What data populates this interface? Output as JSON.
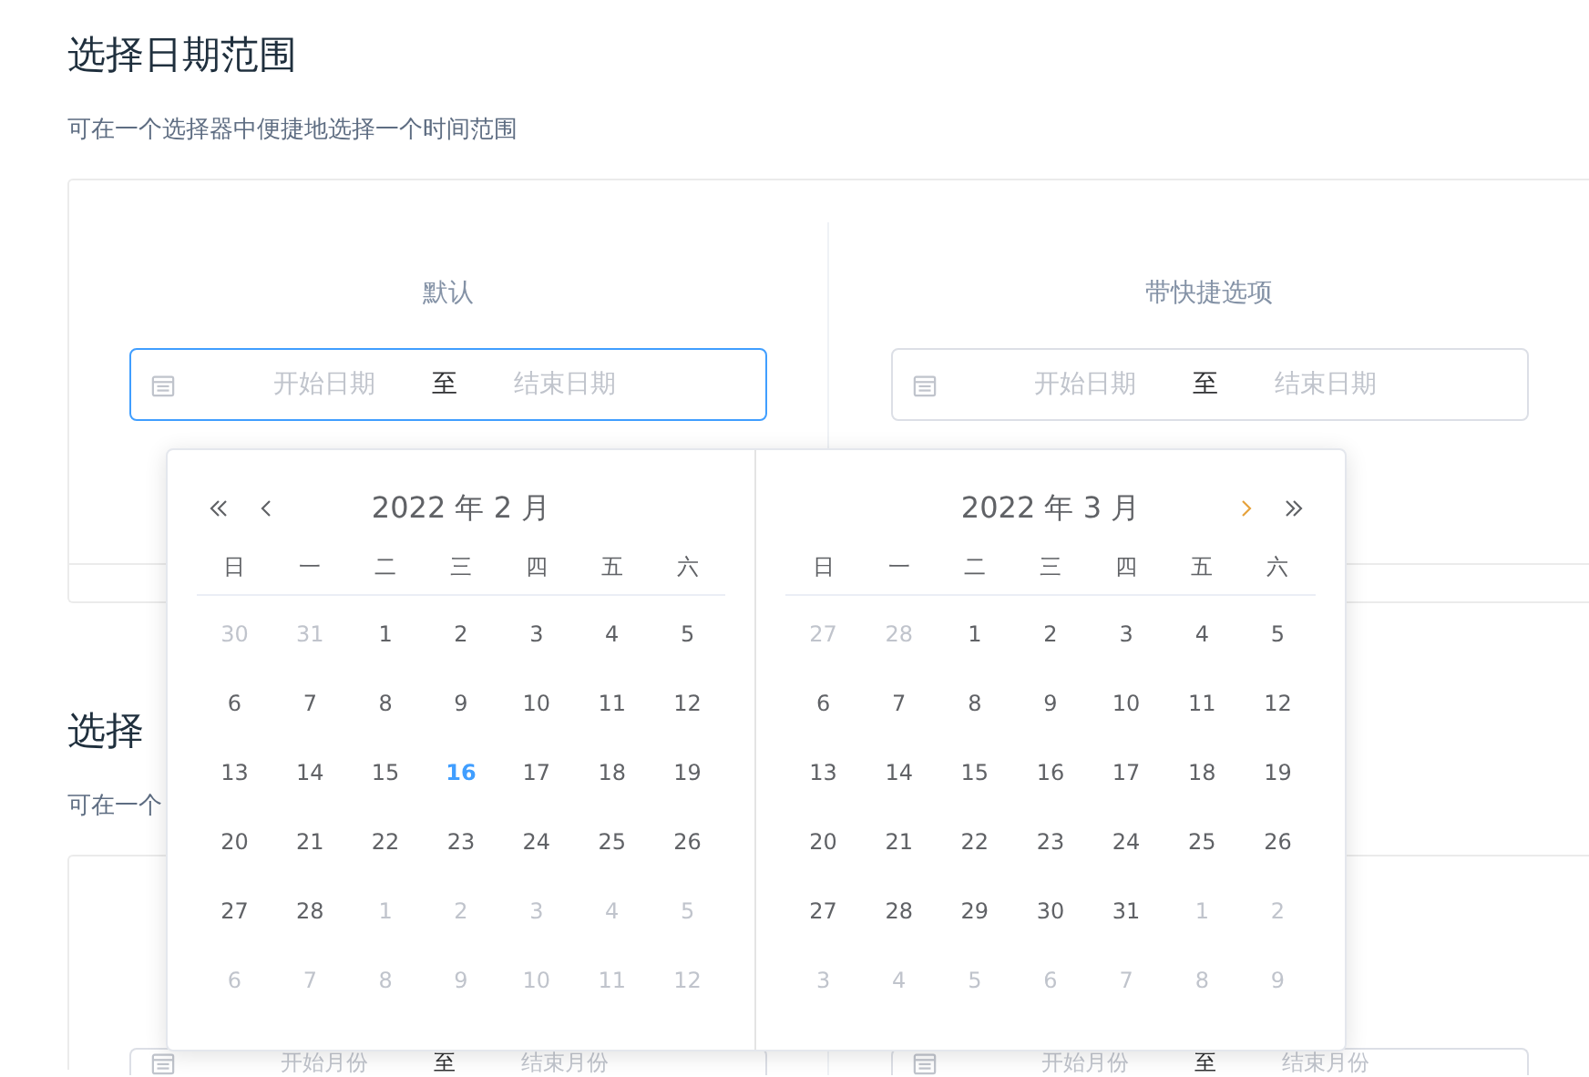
{
  "sections": [
    {
      "title": "选择日期范围",
      "description": "可在一个选择器中便捷地选择一个时间范围",
      "demos": [
        {
          "label": "默认",
          "focused": true,
          "start_placeholder": "开始日期",
          "separator": "至",
          "end_placeholder": "结束日期"
        },
        {
          "label": "带快捷选项",
          "focused": false,
          "start_placeholder": "开始日期",
          "separator": "至",
          "end_placeholder": "结束日期"
        }
      ]
    },
    {
      "title": "选择",
      "description": "可在一个",
      "demos": [
        {
          "focused": false,
          "start_placeholder": "开始月份",
          "separator": "至",
          "end_placeholder": "结束月份"
        },
        {
          "focused": false,
          "start_placeholder": "开始月份",
          "separator": "至",
          "end_placeholder": "结束月份"
        }
      ]
    }
  ],
  "picker": {
    "panels": [
      {
        "title": "2022 年 2 月",
        "weekdays": [
          "日",
          "一",
          "二",
          "三",
          "四",
          "五",
          "六"
        ],
        "days": [
          {
            "text": "30",
            "other_month": true
          },
          {
            "text": "31",
            "other_month": true
          },
          {
            "text": "1",
            "other_month": false
          },
          {
            "text": "2",
            "other_month": false
          },
          {
            "text": "3",
            "other_month": false
          },
          {
            "text": "4",
            "other_month": false
          },
          {
            "text": "5",
            "other_month": false
          },
          {
            "text": "6",
            "other_month": false
          },
          {
            "text": "7",
            "other_month": false
          },
          {
            "text": "8",
            "other_month": false
          },
          {
            "text": "9",
            "other_month": false
          },
          {
            "text": "10",
            "other_month": false
          },
          {
            "text": "11",
            "other_month": false
          },
          {
            "text": "12",
            "other_month": false
          },
          {
            "text": "13",
            "other_month": false
          },
          {
            "text": "14",
            "other_month": false
          },
          {
            "text": "15",
            "other_month": false
          },
          {
            "text": "16",
            "other_month": false,
            "today": true
          },
          {
            "text": "17",
            "other_month": false
          },
          {
            "text": "18",
            "other_month": false
          },
          {
            "text": "19",
            "other_month": false
          },
          {
            "text": "20",
            "other_month": false
          },
          {
            "text": "21",
            "other_month": false
          },
          {
            "text": "22",
            "other_month": false
          },
          {
            "text": "23",
            "other_month": false
          },
          {
            "text": "24",
            "other_month": false
          },
          {
            "text": "25",
            "other_month": false
          },
          {
            "text": "26",
            "other_month": false
          },
          {
            "text": "27",
            "other_month": false
          },
          {
            "text": "28",
            "other_month": false
          },
          {
            "text": "1",
            "other_month": true
          },
          {
            "text": "2",
            "other_month": true
          },
          {
            "text": "3",
            "other_month": true
          },
          {
            "text": "4",
            "other_month": true
          },
          {
            "text": "5",
            "other_month": true
          },
          {
            "text": "6",
            "other_month": true
          },
          {
            "text": "7",
            "other_month": true
          },
          {
            "text": "8",
            "other_month": true
          },
          {
            "text": "9",
            "other_month": true
          },
          {
            "text": "10",
            "other_month": true
          },
          {
            "text": "11",
            "other_month": true
          },
          {
            "text": "12",
            "other_month": true
          }
        ]
      },
      {
        "title": "2022 年 3 月",
        "weekdays": [
          "日",
          "一",
          "二",
          "三",
          "四",
          "五",
          "六"
        ],
        "days": [
          {
            "text": "27",
            "other_month": true
          },
          {
            "text": "28",
            "other_month": true
          },
          {
            "text": "1",
            "other_month": false
          },
          {
            "text": "2",
            "other_month": false
          },
          {
            "text": "3",
            "other_month": false
          },
          {
            "text": "4",
            "other_month": false
          },
          {
            "text": "5",
            "other_month": false
          },
          {
            "text": "6",
            "other_month": false
          },
          {
            "text": "7",
            "other_month": false
          },
          {
            "text": "8",
            "other_month": false
          },
          {
            "text": "9",
            "other_month": false
          },
          {
            "text": "10",
            "other_month": false
          },
          {
            "text": "11",
            "other_month": false
          },
          {
            "text": "12",
            "other_month": false
          },
          {
            "text": "13",
            "other_month": false
          },
          {
            "text": "14",
            "other_month": false
          },
          {
            "text": "15",
            "other_month": false
          },
          {
            "text": "16",
            "other_month": false
          },
          {
            "text": "17",
            "other_month": false
          },
          {
            "text": "18",
            "other_month": false
          },
          {
            "text": "19",
            "other_month": false
          },
          {
            "text": "20",
            "other_month": false
          },
          {
            "text": "21",
            "other_month": false
          },
          {
            "text": "22",
            "other_month": false
          },
          {
            "text": "23",
            "other_month": false
          },
          {
            "text": "24",
            "other_month": false
          },
          {
            "text": "25",
            "other_month": false
          },
          {
            "text": "26",
            "other_month": false
          },
          {
            "text": "27",
            "other_month": false
          },
          {
            "text": "28",
            "other_month": false
          },
          {
            "text": "29",
            "other_month": false
          },
          {
            "text": "30",
            "other_month": false
          },
          {
            "text": "31",
            "other_month": false
          },
          {
            "text": "1",
            "other_month": true
          },
          {
            "text": "2",
            "other_month": true
          },
          {
            "text": "3",
            "other_month": true
          },
          {
            "text": "4",
            "other_month": true
          },
          {
            "text": "5",
            "other_month": true
          },
          {
            "text": "6",
            "other_month": true
          },
          {
            "text": "7",
            "other_month": true
          },
          {
            "text": "8",
            "other_month": true
          },
          {
            "text": "9",
            "other_month": true
          }
        ]
      }
    ]
  }
}
